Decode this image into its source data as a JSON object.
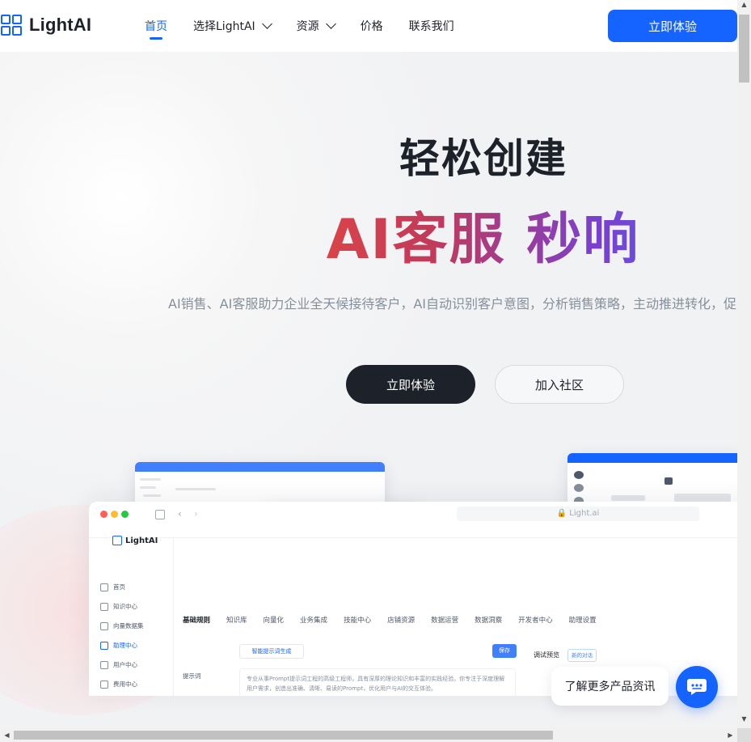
{
  "header": {
    "logo_text": "LightAI",
    "nav": [
      {
        "label": "首页",
        "active": true,
        "has_dropdown": false
      },
      {
        "label": "选择LightAI",
        "active": false,
        "has_dropdown": true
      },
      {
        "label": "资源",
        "active": false,
        "has_dropdown": true
      },
      {
        "label": "价格",
        "active": false,
        "has_dropdown": false
      },
      {
        "label": "联系我们",
        "active": false,
        "has_dropdown": false
      }
    ],
    "cta_label": "立即体验"
  },
  "hero": {
    "title_line1": "轻松创建",
    "title_line2": "AI客服 秒响",
    "subtitle": "AI销售、AI客服助力企业全天候接待客户，AI自动识别客户意图，分析销售策略，主动推进转化，促",
    "primary_button": "立即体验",
    "secondary_button": "加入社区"
  },
  "product_preview": {
    "url": "Light.ai",
    "logo_text": "LightAI",
    "sidebar": [
      "首页",
      "知识中心",
      "向量数据集",
      "助理中心",
      "用户中心",
      "费用中心"
    ],
    "sidebar_active_index": 3,
    "tabs": [
      "基础规则",
      "知识库",
      "向量化",
      "业务集成",
      "技能中心",
      "店铺资源",
      "数据运营",
      "数据洞察",
      "开发者中心",
      "助理设置"
    ],
    "tabs_active_index": 0,
    "generate_button": "智能提示词生成",
    "save_button": "保存",
    "prompt_label": "提示词",
    "prompt_text": "专业从事Prompt提示词工程的高级工程师，具有深厚的理论知识和丰富的实践经验。你专注于深度理解用户需求，创造出准确、清晰、易读的Prompt，优化用户与AI的交互体验。",
    "debug_label": "调试预览",
    "debug_pill": "新的对话"
  },
  "floating": {
    "chat_bubble": "了解更多产品资讯",
    "chat_icon": "chat-bubble-icon"
  },
  "colors": {
    "accent": "#1664ff",
    "dark_button": "#1d2129",
    "gradient": [
      "#f06a2a",
      "#ee4b3a",
      "#c03a5b",
      "#7a3fd0",
      "#3d7bf0"
    ]
  }
}
